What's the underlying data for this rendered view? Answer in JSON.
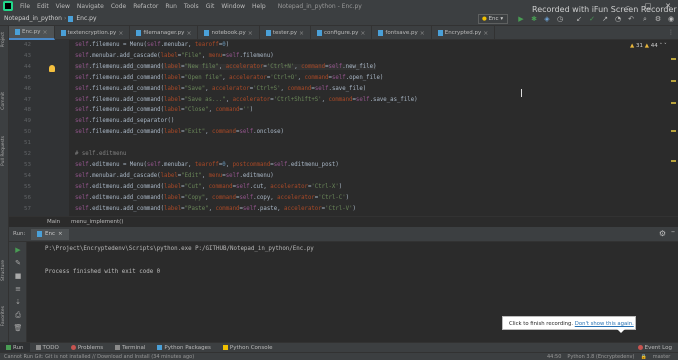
{
  "menubar": {
    "items": [
      "File",
      "Edit",
      "View",
      "Navigate",
      "Code",
      "Refactor",
      "Run",
      "Tools",
      "Git",
      "Window",
      "Help"
    ],
    "file_title": "Notepad_in_python - Enc.py"
  },
  "recording_banner": "Recorded with iFun Screen Recorder",
  "navbar": {
    "project": "Notepad_in_python",
    "file": "Enc.py",
    "run_config": "Enc"
  },
  "tabs": [
    {
      "label": "Enc.py",
      "active": true
    },
    {
      "label": "textencryption.py",
      "active": false
    },
    {
      "label": "filemanager.py",
      "active": false
    },
    {
      "label": "notebook.py",
      "active": false
    },
    {
      "label": "tester.py",
      "active": false
    },
    {
      "label": "configure.py",
      "active": false
    },
    {
      "label": "fontsave.py",
      "active": false
    },
    {
      "label": "Encrypted.py",
      "active": false
    }
  ],
  "left_tools": [
    "Project",
    "Commit",
    "Pull Requests",
    "Structure",
    "Favorites"
  ],
  "inspections": {
    "warnings": "31",
    "weak": "44"
  },
  "editor": {
    "lines": [
      {
        "n": "42",
        "tokens": [
          [
            "self",
            "self"
          ],
          [
            ".filemenu = Menu(",
            "plain"
          ],
          [
            "self",
            "self"
          ],
          [
            ".menubar, ",
            "plain"
          ],
          [
            "tearoff",
            "kw"
          ],
          [
            "=",
            "plain"
          ],
          [
            "0",
            "num"
          ],
          [
            ")",
            "plain"
          ]
        ]
      },
      {
        "n": "43",
        "tokens": [
          [
            "self",
            "self"
          ],
          [
            ".menubar.add_cascade(",
            "plain"
          ],
          [
            "label",
            "kw"
          ],
          [
            "=",
            "plain"
          ],
          [
            "\"File\"",
            "str"
          ],
          [
            ", ",
            "plain"
          ],
          [
            "menu",
            "kw"
          ],
          [
            "=",
            "plain"
          ],
          [
            "self",
            "self"
          ],
          [
            ".filemenu)",
            "plain"
          ]
        ]
      },
      {
        "n": "44",
        "tokens": [
          [
            "self",
            "self"
          ],
          [
            ".filemenu.add_command(",
            "plain"
          ],
          [
            "label",
            "kw"
          ],
          [
            "=",
            "plain"
          ],
          [
            "\"New file\"",
            "str"
          ],
          [
            ", ",
            "plain"
          ],
          [
            "accelerator",
            "kw"
          ],
          [
            "=",
            "plain"
          ],
          [
            "'Ctrl+N'",
            "str"
          ],
          [
            ", ",
            "plain"
          ],
          [
            "command",
            "kw"
          ],
          [
            "=",
            "plain"
          ],
          [
            "self",
            "self"
          ],
          [
            ".new_file)",
            "plain"
          ]
        ]
      },
      {
        "n": "45",
        "tokens": [
          [
            "self",
            "self"
          ],
          [
            ".filemenu.add_command(",
            "plain"
          ],
          [
            "label",
            "kw"
          ],
          [
            "=",
            "plain"
          ],
          [
            "\"Open file\"",
            "str"
          ],
          [
            ", ",
            "plain"
          ],
          [
            "accelerator",
            "kw"
          ],
          [
            "=",
            "plain"
          ],
          [
            "'Ctrl+O'",
            "str"
          ],
          [
            ", ",
            "plain"
          ],
          [
            "command",
            "kw"
          ],
          [
            "=",
            "plain"
          ],
          [
            "self",
            "self"
          ],
          [
            ".open_file)",
            "plain"
          ]
        ]
      },
      {
        "n": "46",
        "tokens": [
          [
            "self",
            "self"
          ],
          [
            ".filemenu.add_command(",
            "plain"
          ],
          [
            "label",
            "kw"
          ],
          [
            "=",
            "plain"
          ],
          [
            "\"Save\"",
            "str"
          ],
          [
            ", ",
            "plain"
          ],
          [
            "accelerator",
            "kw"
          ],
          [
            "=",
            "plain"
          ],
          [
            "'Ctrl+S'",
            "str"
          ],
          [
            ", ",
            "plain"
          ],
          [
            "command",
            "kw"
          ],
          [
            "=",
            "plain"
          ],
          [
            "self",
            "self"
          ],
          [
            ".save_file)",
            "plain"
          ]
        ]
      },
      {
        "n": "47",
        "tokens": [
          [
            "self",
            "self"
          ],
          [
            ".filemenu.add_command(",
            "plain"
          ],
          [
            "label",
            "kw"
          ],
          [
            "=",
            "plain"
          ],
          [
            "\"Save as...\"",
            "str"
          ],
          [
            ", ",
            "plain"
          ],
          [
            "accelerator",
            "kw"
          ],
          [
            "=",
            "plain"
          ],
          [
            "'Ctrl+Shift+S'",
            "str"
          ],
          [
            ", ",
            "plain"
          ],
          [
            "command",
            "kw"
          ],
          [
            "=",
            "plain"
          ],
          [
            "self",
            "self"
          ],
          [
            ".save_as_file)",
            "plain"
          ]
        ]
      },
      {
        "n": "48",
        "tokens": [
          [
            "self",
            "self"
          ],
          [
            ".filemenu.add_command(",
            "plain"
          ],
          [
            "label",
            "kw"
          ],
          [
            "=",
            "plain"
          ],
          [
            "\"Close\"",
            "str"
          ],
          [
            ", ",
            "plain"
          ],
          [
            "command",
            "kw"
          ],
          [
            "=",
            "plain"
          ],
          [
            "''",
            "str"
          ],
          [
            ")",
            "plain"
          ]
        ]
      },
      {
        "n": "49",
        "tokens": [
          [
            "self",
            "self"
          ],
          [
            ".filemenu.add_separator()",
            "plain"
          ]
        ]
      },
      {
        "n": "50",
        "tokens": [
          [
            "self",
            "self"
          ],
          [
            ".filemenu.add_command(",
            "plain"
          ],
          [
            "label",
            "kw"
          ],
          [
            "=",
            "plain"
          ],
          [
            "\"Exit\"",
            "str"
          ],
          [
            ", ",
            "plain"
          ],
          [
            "command",
            "kw"
          ],
          [
            "=",
            "plain"
          ],
          [
            "self",
            "self"
          ],
          [
            ".onclose)",
            "plain"
          ]
        ]
      },
      {
        "n": "51",
        "tokens": []
      },
      {
        "n": "52",
        "tokens": [
          [
            "# self.editmenu",
            "com"
          ]
        ]
      },
      {
        "n": "53",
        "tokens": [
          [
            "self",
            "self"
          ],
          [
            ".editmenu = Menu(",
            "plain"
          ],
          [
            "self",
            "self"
          ],
          [
            ".menubar, ",
            "plain"
          ],
          [
            "tearoff",
            "kw"
          ],
          [
            "=",
            "plain"
          ],
          [
            "0",
            "num"
          ],
          [
            ", ",
            "plain"
          ],
          [
            "postcommand",
            "kw"
          ],
          [
            "=",
            "plain"
          ],
          [
            "self",
            "self"
          ],
          [
            ".editmenu_post)",
            "plain"
          ]
        ]
      },
      {
        "n": "54",
        "tokens": [
          [
            "self",
            "self"
          ],
          [
            ".menubar.add_cascade(",
            "plain"
          ],
          [
            "label",
            "kw"
          ],
          [
            "=",
            "plain"
          ],
          [
            "\"Edit\"",
            "str"
          ],
          [
            ", ",
            "plain"
          ],
          [
            "menu",
            "kw"
          ],
          [
            "=",
            "plain"
          ],
          [
            "self",
            "self"
          ],
          [
            ".editmenu)",
            "plain"
          ]
        ]
      },
      {
        "n": "55",
        "tokens": [
          [
            "self",
            "self"
          ],
          [
            ".editmenu.add_command(",
            "plain"
          ],
          [
            "label",
            "kw"
          ],
          [
            "=",
            "plain"
          ],
          [
            "\"Cut\"",
            "str"
          ],
          [
            ", ",
            "plain"
          ],
          [
            "command",
            "kw"
          ],
          [
            "=",
            "plain"
          ],
          [
            "self",
            "self"
          ],
          [
            ".cut, ",
            "plain"
          ],
          [
            "accelerator",
            "kw"
          ],
          [
            "=",
            "plain"
          ],
          [
            "'Ctrl-X'",
            "str"
          ],
          [
            ")",
            "plain"
          ]
        ]
      },
      {
        "n": "56",
        "tokens": [
          [
            "self",
            "self"
          ],
          [
            ".editmenu.add_command(",
            "plain"
          ],
          [
            "label",
            "kw"
          ],
          [
            "=",
            "plain"
          ],
          [
            "\"Copy\"",
            "str"
          ],
          [
            ", ",
            "plain"
          ],
          [
            "command",
            "kw"
          ],
          [
            "=",
            "plain"
          ],
          [
            "self",
            "self"
          ],
          [
            ".copy, ",
            "plain"
          ],
          [
            "accelerator",
            "kw"
          ],
          [
            "=",
            "plain"
          ],
          [
            "'Ctrl-C'",
            "str"
          ],
          [
            ")",
            "plain"
          ]
        ]
      },
      {
        "n": "57",
        "tokens": [
          [
            "self",
            "self"
          ],
          [
            ".editmenu.add_command(",
            "plain"
          ],
          [
            "label",
            "kw"
          ],
          [
            "=",
            "plain"
          ],
          [
            "\"Paste\"",
            "str"
          ],
          [
            ", ",
            "plain"
          ],
          [
            "command",
            "kw"
          ],
          [
            "=",
            "plain"
          ],
          [
            "self",
            "self"
          ],
          [
            ".paste, ",
            "plain"
          ],
          [
            "accelerator",
            "kw"
          ],
          [
            "=",
            "plain"
          ],
          [
            "'Ctrl-V'",
            "str"
          ],
          [
            ")",
            "plain"
          ]
        ]
      }
    ]
  },
  "editor_breadcrumbs": [
    "Main",
    "menu_implement()"
  ],
  "run_panel": {
    "label": "Run:",
    "tab": "Enc",
    "command": "P:\\Project\\Encryptedenv\\Scripts\\python.exe P:/GITHUB/Notepad_in_python/Enc.py",
    "exit_message": "Process finished with exit code 0"
  },
  "tooltip": {
    "text": "Click to finish recording.",
    "link": "Don't show this again."
  },
  "tool_tabs": [
    "Run",
    "TODO",
    "Problems",
    "Terminal",
    "Python Packages",
    "Python Console"
  ],
  "event_log": "Event Log",
  "status": {
    "message": "Cannot Run Git: Git is not installed // Download and Install (34 minutes ago)",
    "position": "44:50",
    "interpreter": "Python 3.8 (Encryptedenv)",
    "branch": "master"
  },
  "colors": {
    "accent": "#4a88c7",
    "run_green": "#499c54",
    "bg": "#2b2b2b",
    "panel": "#3c3f41"
  }
}
